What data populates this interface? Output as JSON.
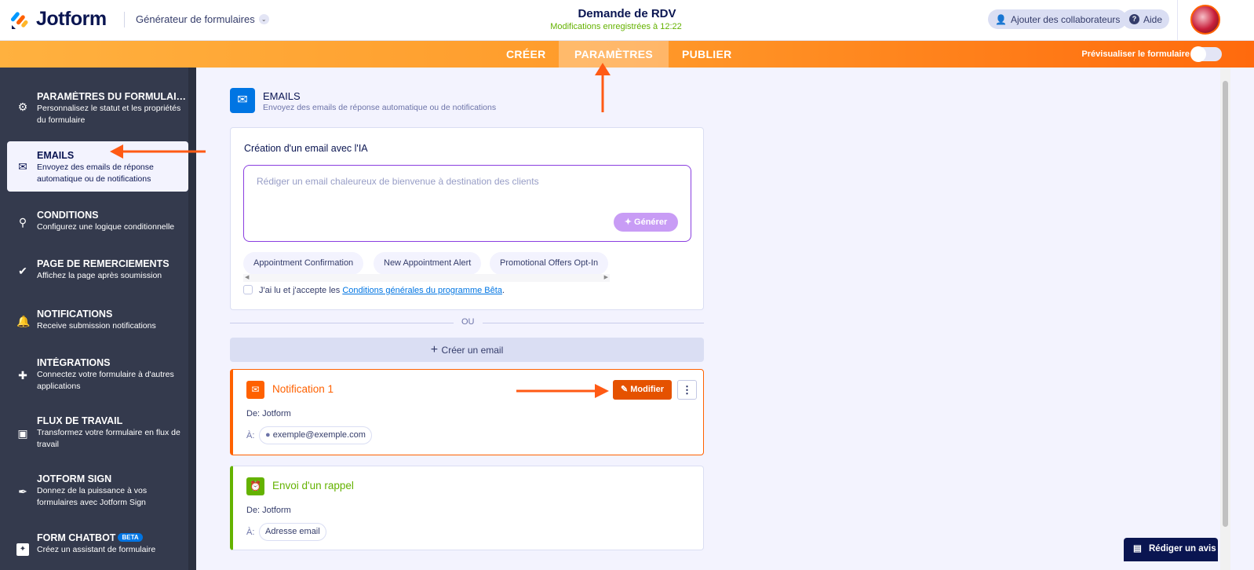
{
  "header": {
    "logo": "Jotform",
    "builder": "Générateur de formulaires",
    "form_title": "Demande de RDV",
    "saved_status": "Modifications enregistrées à 12:22",
    "add_collaborators": "Ajouter des collaborateurs",
    "help": "Aide"
  },
  "nav": {
    "tabs": [
      {
        "label": "CRÉER"
      },
      {
        "label": "PARAMÈTRES"
      },
      {
        "label": "PUBLIER"
      }
    ],
    "preview_label": "Prévisualiser le formulaire",
    "preview_on": false
  },
  "sidebar": {
    "items": [
      {
        "title": "PARAMÈTRES DU FORMULAIRE",
        "desc": "Personnalisez le statut et les propriétés du formulaire"
      },
      {
        "title": "EMAILS",
        "desc": "Envoyez des emails de réponse automatique ou de notifications"
      },
      {
        "title": "CONDITIONS",
        "desc": "Configurez une logique conditionnelle"
      },
      {
        "title": "PAGE DE REMERCIEMENTS",
        "desc": "Affichez la page après soumission"
      },
      {
        "title": "NOTIFICATIONS",
        "desc": "Receive submission notifications"
      },
      {
        "title": "INTÉGRATIONS",
        "desc": "Connectez votre formulaire à d'autres applications"
      },
      {
        "title": "FLUX DE TRAVAIL",
        "desc": "Transformez votre formulaire en flux de travail"
      },
      {
        "title": "JOTFORM SIGN",
        "desc": "Donnez de la puissance à vos formulaires avec Jotform Sign"
      },
      {
        "title": "FORM CHATBOT",
        "badge": "BETA",
        "desc": "Créez un assistant de formulaire"
      }
    ]
  },
  "main": {
    "title": "EMAILS",
    "desc": "Envoyez des emails de réponse automatique ou de notifications",
    "ai": {
      "title": "Création d'un email avec l'IA",
      "placeholder": "Rédiger un email chaleureux de bienvenue à destination des clients",
      "generate": "Générer",
      "suggestions": [
        "Appointment Confirmation",
        "New Appointment Alert",
        "Promotional Offers Opt-In"
      ],
      "terms_prefix": "J'ai lu et j'accepte les ",
      "terms_link": "Conditions générales du programme Bêta",
      "terms_suffix": "."
    },
    "or": "OU",
    "create": "Créer un email",
    "emails": [
      {
        "title": "Notification 1",
        "from": "De: Jotform",
        "to_label": "À:",
        "to": "exemple@exemple.com",
        "edit": "Modifier",
        "color": "#ff6100"
      },
      {
        "title": "Envoi d'un rappel",
        "from": "De: Jotform",
        "to_label": "À:",
        "to": "Adresse email",
        "color": "#64b200"
      }
    ]
  },
  "review": "Rédiger un avis"
}
